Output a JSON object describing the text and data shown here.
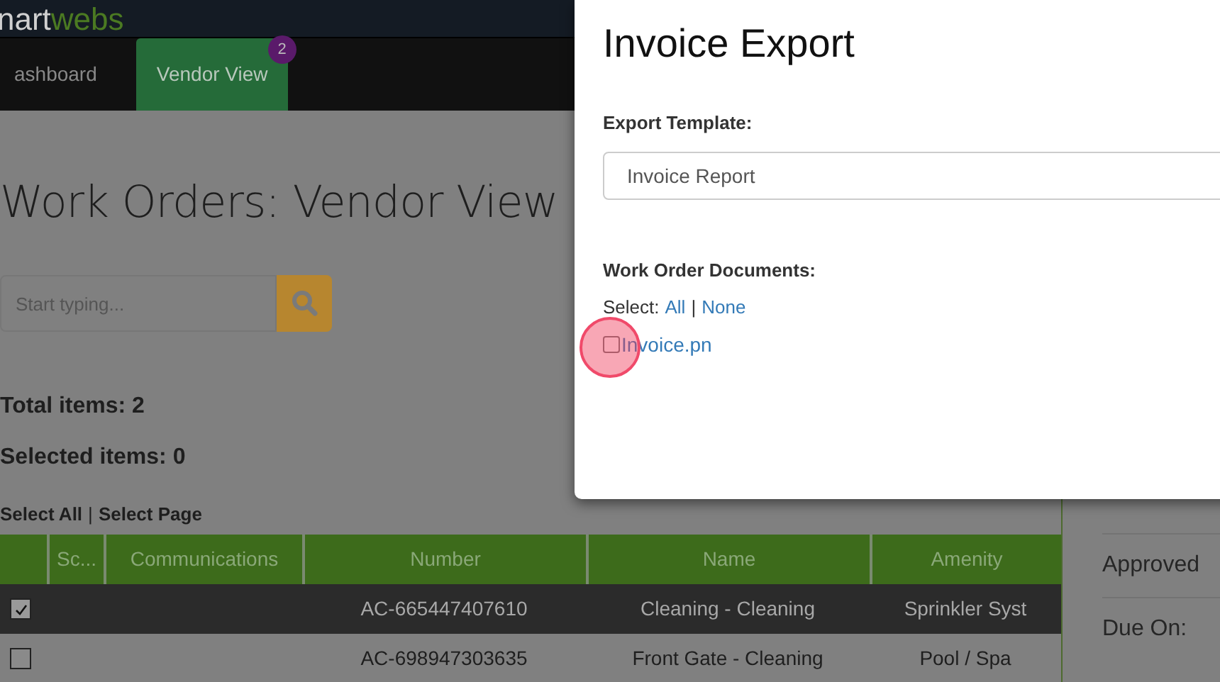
{
  "brand": {
    "first": "nart",
    "second": "webs"
  },
  "nav": [
    {
      "label": "ashboard",
      "selected": false
    },
    {
      "label": "Vendor View",
      "selected": true,
      "badge": "2"
    }
  ],
  "page": {
    "title": "Work Orders: Vendor View",
    "search": {
      "placeholder": "Start typing..."
    },
    "total": "Total items: 2",
    "selected_count": "Selected items: 0",
    "select_all": "Select All",
    "separator": "|",
    "select_page": "Select Page"
  },
  "table": {
    "columns": [
      "",
      "Sc...",
      "Communications",
      "Number",
      "Name",
      "Amenity"
    ],
    "rows": [
      {
        "selected": true,
        "cells": [
          "",
          "",
          "",
          "AC-665447407610",
          "Cleaning - Cleaning",
          "Sprinkler Syst"
        ]
      },
      {
        "selected": false,
        "cells": [
          "",
          "",
          "",
          "AC-698947303635",
          "Front Gate - Cleaning",
          "Pool / Spa"
        ]
      }
    ]
  },
  "side_panel": {
    "rows": [
      "Approved",
      "Due On:"
    ]
  },
  "modal": {
    "title": "Invoice Export",
    "template_label": "Export Template:",
    "template_value": "Invoice Report",
    "documents_label": "Work Order Documents:",
    "select_label": "Select:",
    "select_all": "All",
    "select_separator": "|",
    "select_none": "None",
    "documents": [
      {
        "name": "Invoice.pn",
        "checked": false
      }
    ]
  }
}
